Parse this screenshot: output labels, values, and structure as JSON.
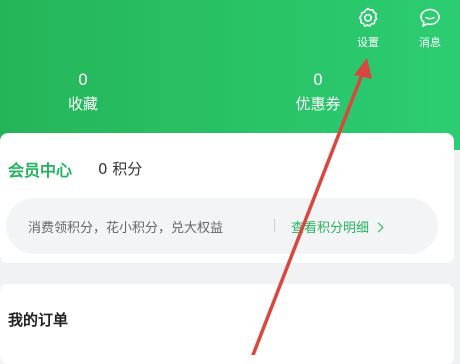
{
  "header": {
    "settings_label": "设置",
    "messages_label": "消息",
    "stats": [
      {
        "value": "0",
        "label": "收藏"
      },
      {
        "value": "0",
        "label": "优惠券"
      }
    ],
    "colors": {
      "gradient_start": "#25b559",
      "gradient_end": "#2ccd72"
    }
  },
  "member": {
    "title": "会员中心",
    "points": "0 积分",
    "tip": "消费领积分，花小积分，兑大权益",
    "link": "查看积分明细"
  },
  "orders": {
    "title": "我的订单"
  },
  "annotation": {
    "color": "#d9473e"
  }
}
